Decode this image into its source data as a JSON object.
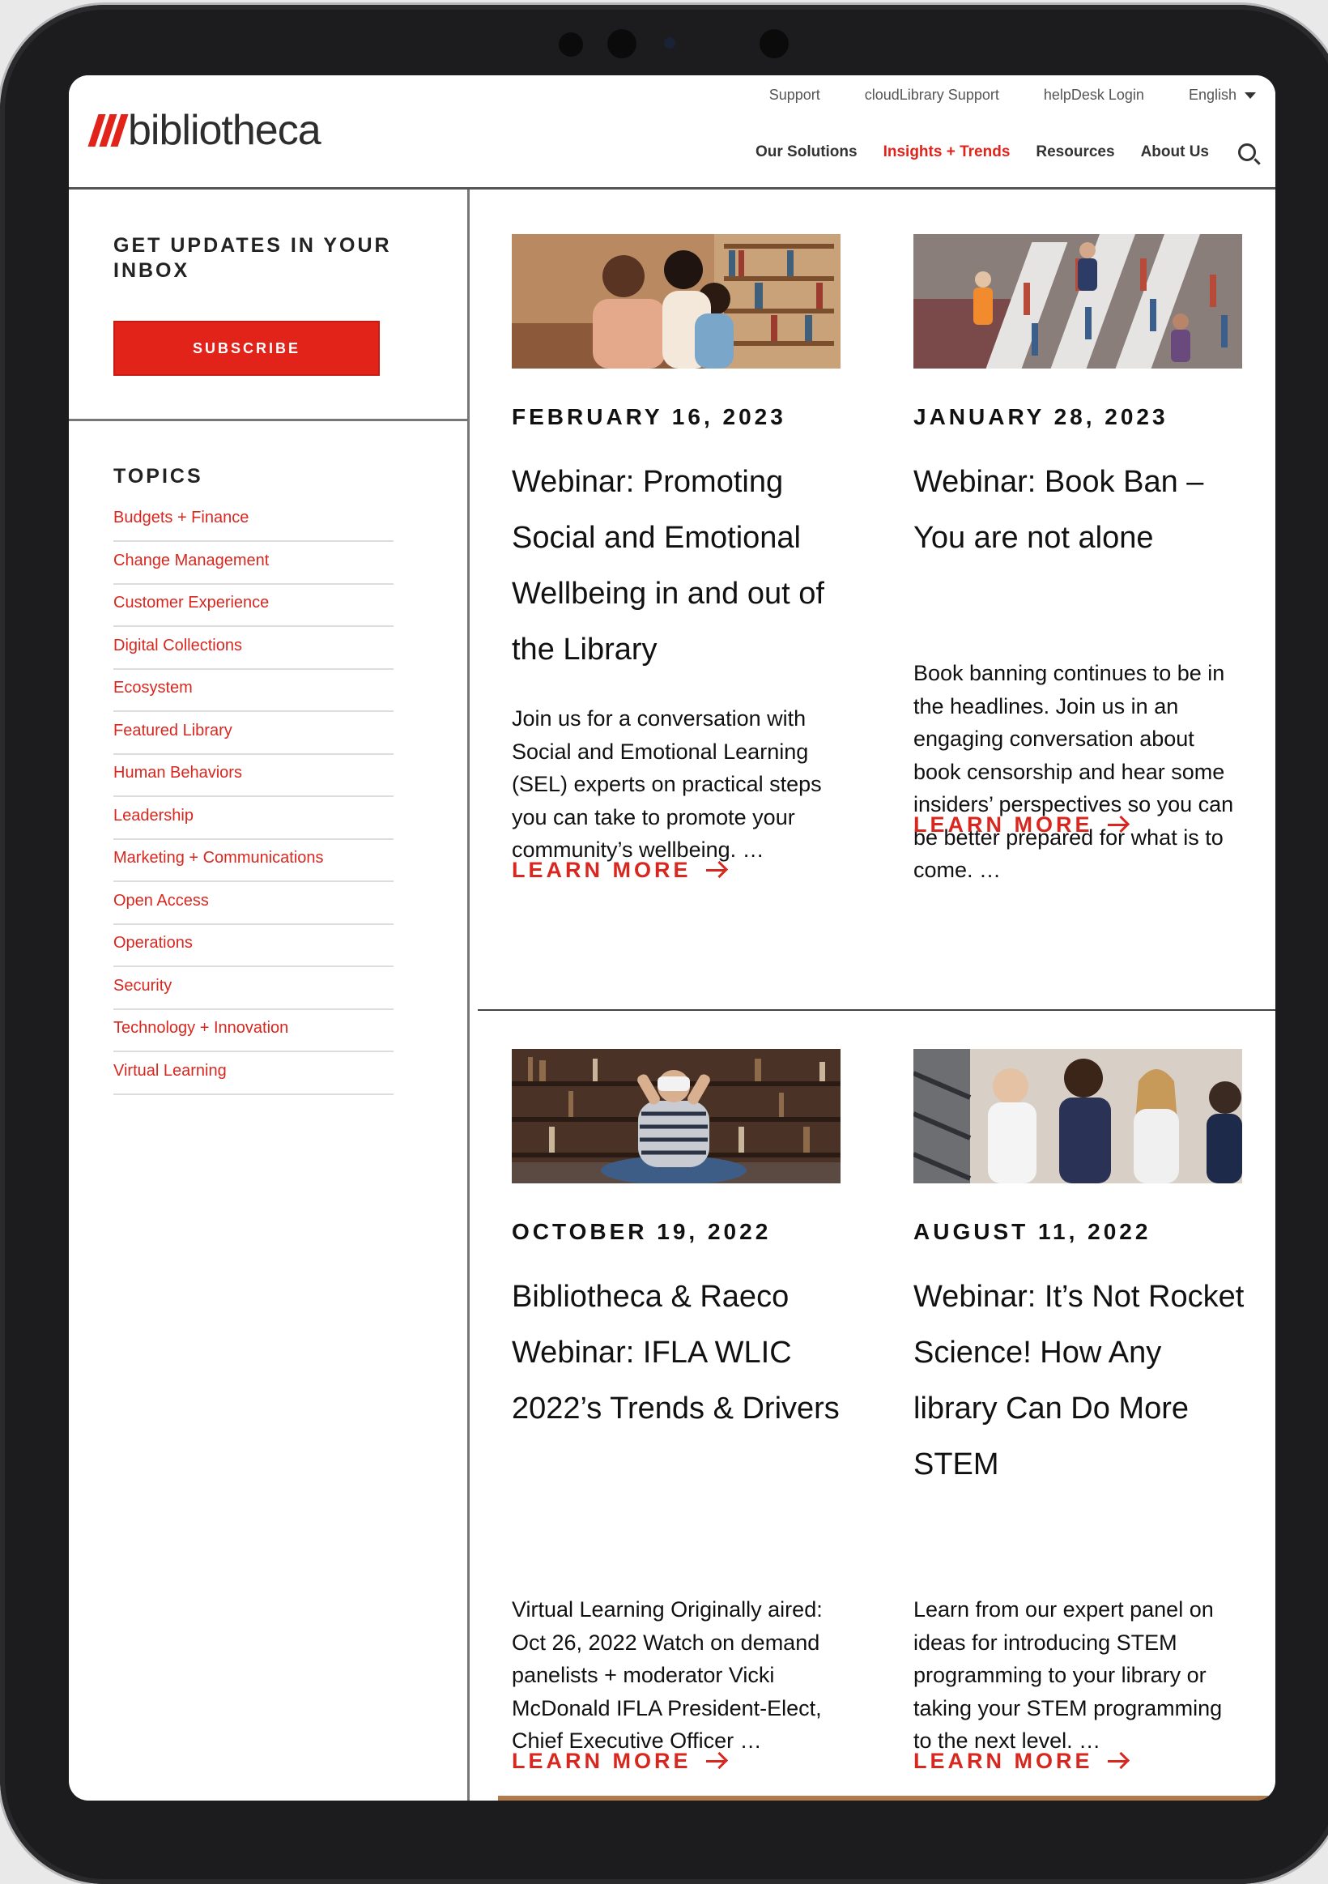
{
  "header": {
    "logo_text": "bibliotheca",
    "utility_nav": [
      "Support",
      "cloudLibrary Support",
      "helpDesk Login"
    ],
    "language": "English",
    "main_nav": [
      {
        "label": "Our Solutions",
        "active": false
      },
      {
        "label": "Insights + Trends",
        "active": true
      },
      {
        "label": "Resources",
        "active": false
      },
      {
        "label": "About Us",
        "active": false
      }
    ]
  },
  "sidebar": {
    "updates_heading": "GET UPDATES IN YOUR INBOX",
    "subscribe_label": "SUBSCRIBE",
    "topics_heading": "TOPICS",
    "topics": [
      "Budgets + Finance",
      "Change Management",
      "Customer Experience",
      "Digital Collections",
      "Ecosystem",
      "Featured Library",
      "Human Behaviors",
      "Leadership",
      "Marketing + Communications",
      "Open Access",
      "Operations",
      "Security",
      "Technology + Innovation",
      "Virtual Learning"
    ]
  },
  "articles": [
    {
      "date": "FEBRUARY 16, 2023",
      "title": "Webinar: Promoting Social and Emotional Wellbeing in and out of the Library",
      "excerpt": "Join us for a conversation with Social and Emotional Learning (SEL) experts on practical steps you can take to promote your community’s wellbeing.  …",
      "cta": "LEARN MORE"
    },
    {
      "date": "JANUARY 28, 2023",
      "title": "Webinar: Book Ban – You are not alone",
      "excerpt": "Book banning continues to be in the headlines. Join us in an engaging conversation about book censorship and hear some insiders’ perspectives so you can be better prepared for what is to come. …",
      "cta": "LEARN MORE"
    },
    {
      "date": "OCTOBER 19, 2022",
      "title": "Bibliotheca & Raeco Webinar: IFLA WLIC 2022’s Trends & Drivers",
      "excerpt": "Virtual Learning Originally aired: Oct 26, 2022 Watch on demand panelists + moderator Vicki McDonald IFLA President-Elect, Chief Executive Officer …",
      "cta": "LEARN MORE"
    },
    {
      "date": "AUGUST 11, 2022",
      "title": "Webinar: It’s Not Rocket Science! How Any library Can Do More STEM",
      "excerpt": "Learn from our expert panel on ideas for introducing STEM programming to your library or taking your STEM programming to the next level. …",
      "cta": "LEARN MORE"
    }
  ],
  "colors": {
    "brand_red": "#e2231a",
    "text": "#111111"
  }
}
